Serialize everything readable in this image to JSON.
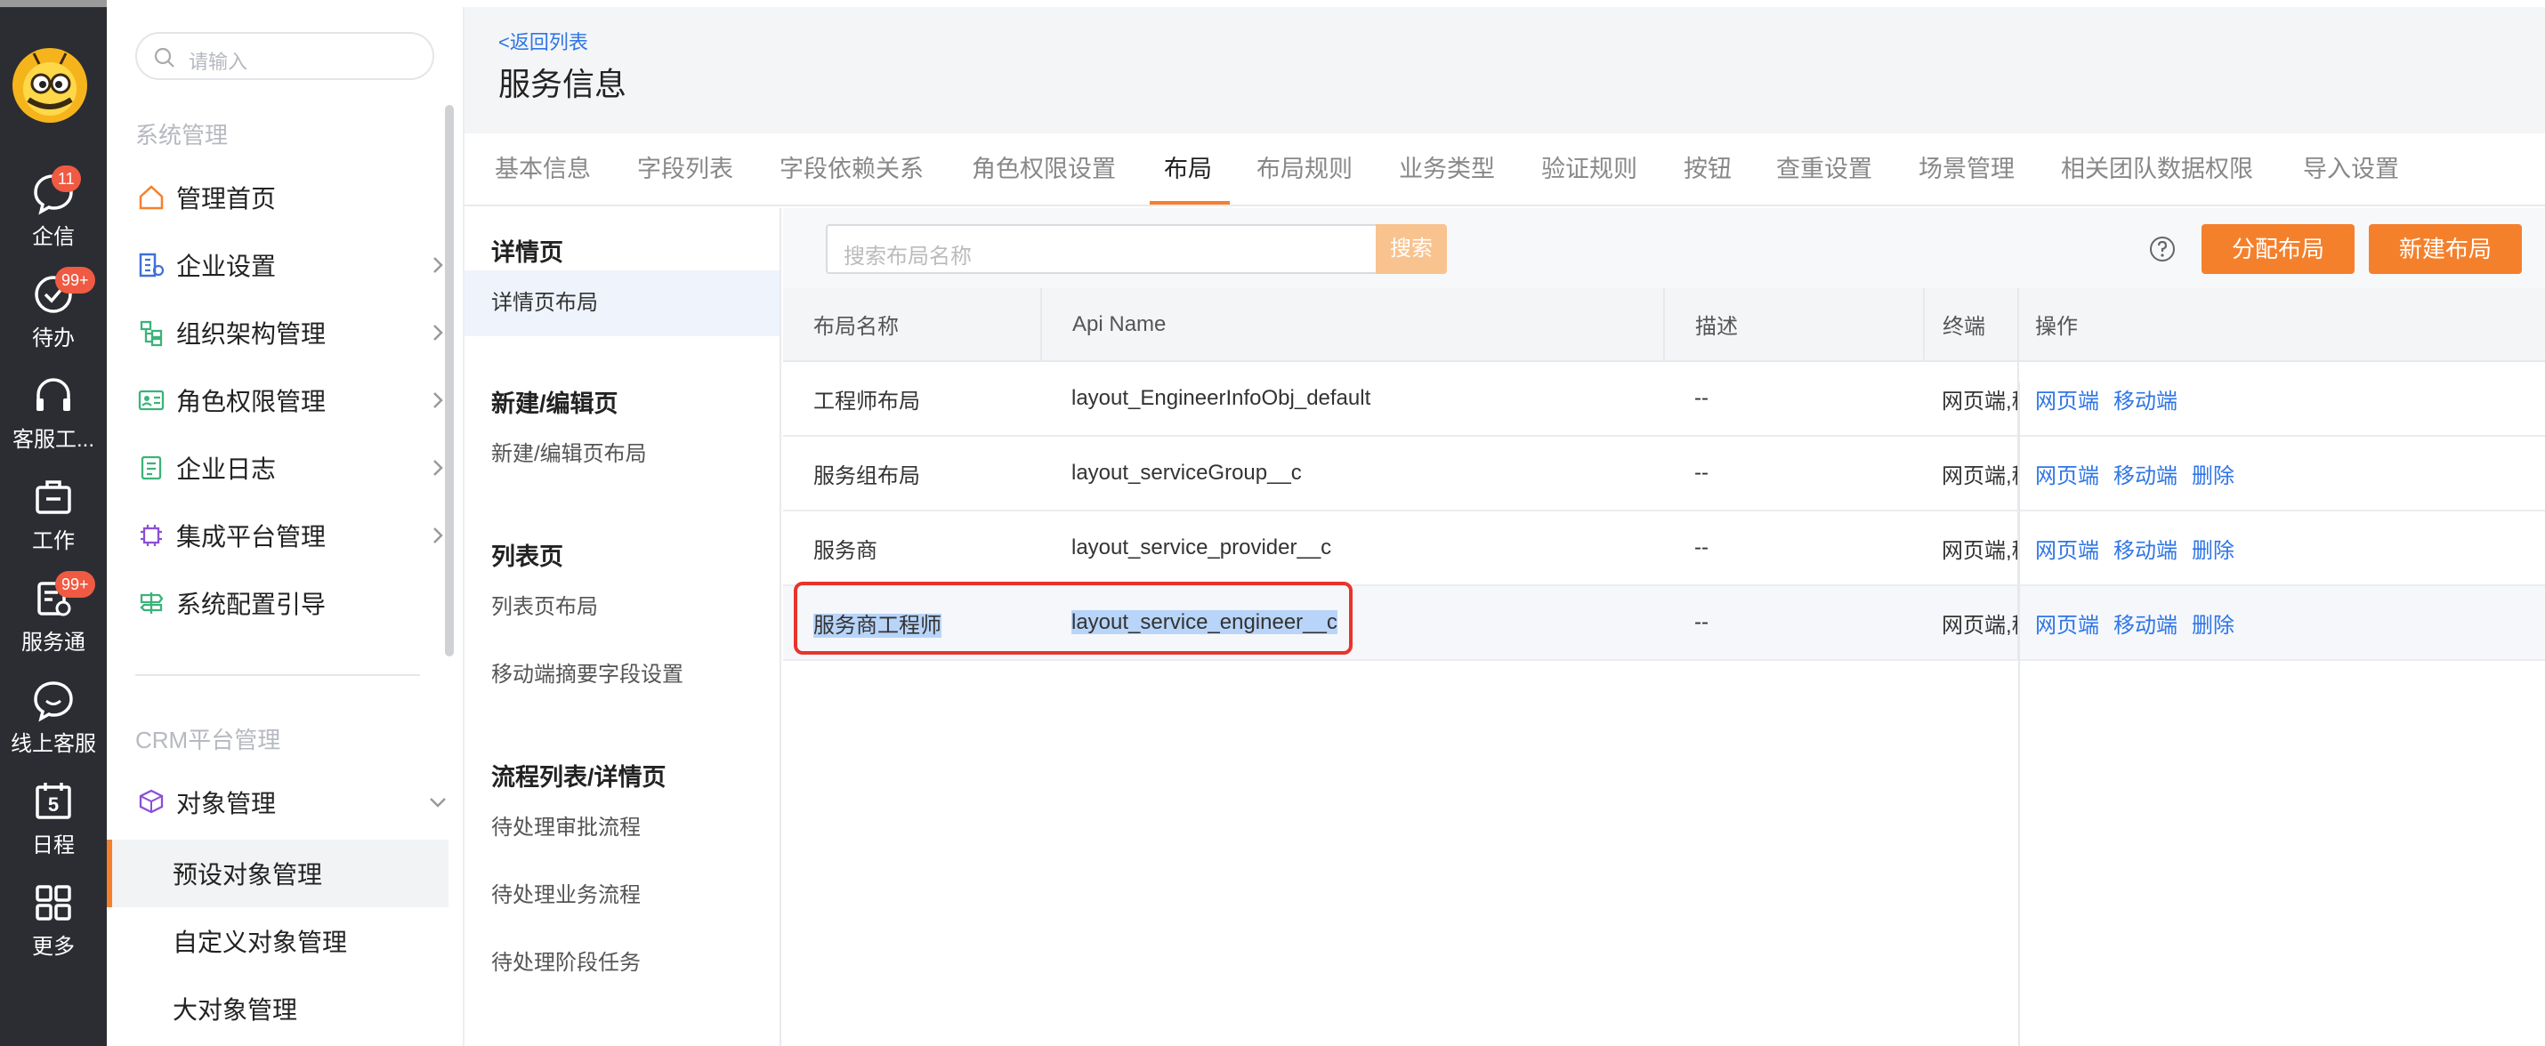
{
  "rail": {
    "items": [
      {
        "label": "企信",
        "badge": "11"
      },
      {
        "label": "待办",
        "badge": "99+"
      },
      {
        "label": "客服工..."
      },
      {
        "label": "工作"
      },
      {
        "label": "服务通",
        "badge": "99+"
      },
      {
        "label": "线上客服"
      },
      {
        "label": "日程",
        "day": "5"
      },
      {
        "label": "更多"
      }
    ]
  },
  "nav": {
    "search_placeholder": "请输入",
    "section1": "系统管理",
    "items": [
      {
        "label": "管理首页"
      },
      {
        "label": "企业设置"
      },
      {
        "label": "组织架构管理"
      },
      {
        "label": "角色权限管理"
      },
      {
        "label": "企业日志"
      },
      {
        "label": "集成平台管理"
      },
      {
        "label": "系统配置引导"
      }
    ],
    "section2": "CRM平台管理",
    "object_mgmt": "对象管理",
    "sub_items": [
      "预设对象管理",
      "自定义对象管理",
      "大对象管理"
    ]
  },
  "header": {
    "back": "<返回列表",
    "title": "服务信息",
    "tabs": [
      "基本信息",
      "字段列表",
      "字段依赖关系",
      "角色权限设置",
      "布局",
      "布局规则",
      "业务类型",
      "验证规则",
      "按钮",
      "查重设置",
      "场景管理",
      "相关团队数据权限",
      "导入设置"
    ],
    "active_tab": "布局"
  },
  "subnav": {
    "groups": [
      {
        "title": "详情页",
        "items": [
          "详情页布局"
        ]
      },
      {
        "title": "新建/编辑页",
        "items": [
          "新建/编辑页布局"
        ]
      },
      {
        "title": "列表页",
        "items": [
          "列表页布局",
          "移动端摘要字段设置"
        ]
      },
      {
        "title": "流程列表/详情页",
        "items": [
          "待处理审批流程",
          "待处理业务流程",
          "待处理阶段任务"
        ]
      }
    ]
  },
  "toolbar": {
    "search_placeholder": "搜索布局名称",
    "search_btn": "搜索",
    "assign_btn": "分配布局",
    "new_btn": "新建布局"
  },
  "table": {
    "columns": [
      "布局名称",
      "Api Name",
      "描述",
      "终端",
      "操作"
    ],
    "rows": [
      {
        "name": "工程师布局",
        "api": "layout_EngineerInfoObj_default",
        "desc": "--",
        "terminal": "网页端,移动端",
        "ops": [
          "网页端",
          "移动端"
        ]
      },
      {
        "name": "服务组布局",
        "api": "layout_serviceGroup__c",
        "desc": "--",
        "terminal": "网页端,移动端",
        "ops": [
          "网页端",
          "移动端",
          "删除"
        ]
      },
      {
        "name": "服务商",
        "api": "layout_service_provider__c",
        "desc": "--",
        "terminal": "网页端,移动端",
        "ops": [
          "网页端",
          "移动端",
          "删除"
        ]
      },
      {
        "name": "服务商工程师",
        "api": "layout_service_engineer__c",
        "desc": "--",
        "terminal": "网页端,移动端",
        "ops": [
          "网页端",
          "移动端",
          "删除"
        ]
      }
    ]
  },
  "colors": {
    "accent": "#f5802c",
    "link": "#2e75e6",
    "rail": "#2b2d33",
    "badge": "#f05a42",
    "highlight_box": "#e8342c"
  }
}
